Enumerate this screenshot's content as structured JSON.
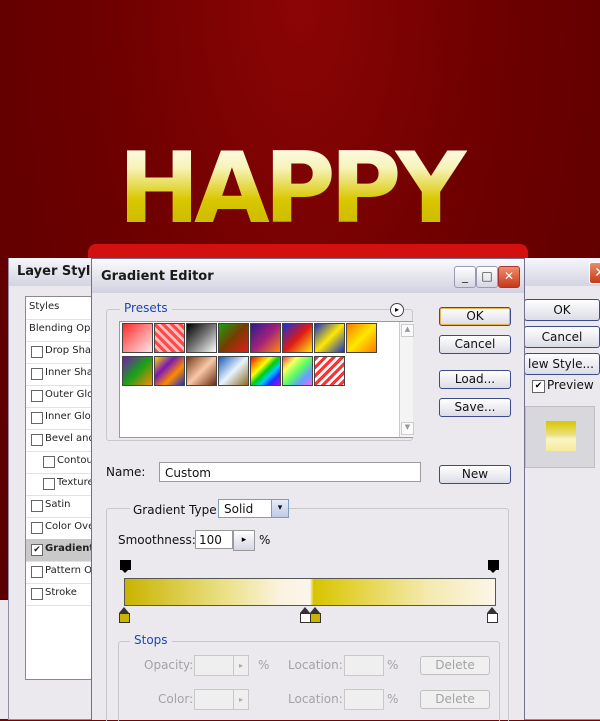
{
  "artwork": {
    "title_text": "HAPPY"
  },
  "layer_style": {
    "title": "Layer Style",
    "close_glyph": "✕",
    "styles_header": "Styles",
    "items": [
      {
        "label": "Blending Optio",
        "checkbox": false,
        "checked": false,
        "selected": false
      },
      {
        "label": "Drop Shad",
        "checkbox": true,
        "checked": false,
        "selected": false
      },
      {
        "label": "Inner Shac",
        "checkbox": true,
        "checked": false,
        "selected": false
      },
      {
        "label": "Outer Glow",
        "checkbox": true,
        "checked": false,
        "selected": false
      },
      {
        "label": "Inner Glow",
        "checkbox": true,
        "checked": false,
        "selected": false
      },
      {
        "label": "Bevel and E",
        "checkbox": true,
        "checked": false,
        "selected": false
      },
      {
        "label": "Contour",
        "checkbox": true,
        "checked": false,
        "selected": false
      },
      {
        "label": "Texture",
        "checkbox": true,
        "checked": false,
        "selected": false
      },
      {
        "label": "Satin",
        "checkbox": true,
        "checked": false,
        "selected": false
      },
      {
        "label": "Color Over",
        "checkbox": true,
        "checked": false,
        "selected": false
      },
      {
        "label": "Gradient C",
        "checkbox": true,
        "checked": true,
        "selected": true
      },
      {
        "label": "Pattern Ov",
        "checkbox": true,
        "checked": false,
        "selected": false
      },
      {
        "label": "Stroke",
        "checkbox": true,
        "checked": false,
        "selected": false
      }
    ],
    "ok_label": "OK",
    "cancel_label": "Cancel",
    "new_style_label": "lew Style...",
    "preview_label": "Preview",
    "preview_checked": true
  },
  "gradient_editor": {
    "title": "Gradient Editor",
    "minimize_glyph": "_",
    "maximize_glyph": "□",
    "close_glyph": "✕",
    "presets_label": "Presets",
    "presets_menu_glyph": "▸",
    "presets": [
      {
        "name": "red-to-transparent",
        "gradient": "linear-gradient(135deg,#ff2a2a 0%,#ff8a8a 50%,#ffe5e5 100%)"
      },
      {
        "name": "red-checker",
        "gradient": "repeating-linear-gradient(45deg,#ff4a4a 0 3px,#ffbdbd 3px 6px)"
      },
      {
        "name": "black-to-white",
        "gradient": "linear-gradient(135deg,#000 0%,#777 50%,#fff 100%)"
      },
      {
        "name": "red-to-green",
        "gradient": "linear-gradient(135deg,#1aa010 0%,#7a3a00 50%,#e21f1f 100%)"
      },
      {
        "name": "violet-to-orange",
        "gradient": "linear-gradient(135deg,#2d1a8c 0%,#a0207a 50%,#ff8a10 100%)"
      },
      {
        "name": "blue-red-yellow",
        "gradient": "linear-gradient(135deg,#1830d8 0%,#e01818 50%,#ffe810 100%)"
      },
      {
        "name": "blue-yellow-blue",
        "gradient": "linear-gradient(135deg,#1830c8 0%,#ffe800 50%,#1830c8 100%)"
      },
      {
        "name": "orange-yellow-orange",
        "gradient": "linear-gradient(135deg,#ff7a00 0%,#ffe800 50%,#ff7a00 100%)"
      },
      {
        "name": "violet-green-orange",
        "gradient": "linear-gradient(135deg,#7a18b8 0%,#18a018 50%,#ff8a00 100%)"
      },
      {
        "name": "yellow-violet-orange-blue",
        "gradient": "linear-gradient(135deg,#ffd800 0%,#7a18b8 35%,#ff8a00 65%,#1830c8 100%)"
      },
      {
        "name": "copper",
        "gradient": "linear-gradient(135deg,#7a3a18 0%,#f8c8a8 50%,#6a2a10 100%)"
      },
      {
        "name": "chrome",
        "gradient": "linear-gradient(135deg,#1a5ab8 0%,#e8f4ff 50%,#8a6a20 100%)"
      },
      {
        "name": "spectrum",
        "gradient": "linear-gradient(135deg,#ff0000 0%,#ff9a00 20%,#ffff00 35%,#00d000 50%,#00c8ff 65%,#1a30ff 80%,#c000ff 100%)"
      },
      {
        "name": "transparent-rainbow",
        "gradient": "linear-gradient(135deg,#ff4040 0%,#ffff60 25%,#60ff60 50%,#60a0ff 75%,#ff60ff 100%)"
      },
      {
        "name": "transparent-stripes",
        "gradient": "repeating-linear-gradient(135deg,#ff3030 0 3px,#ffffff 3px 6px)"
      }
    ],
    "ok_label": "OK",
    "cancel_label": "Cancel",
    "load_label": "Load...",
    "save_label": "Save...",
    "name_label": "Name:",
    "name_value": "Custom",
    "new_label": "New",
    "gradient_type_label": "Gradient Type:",
    "gradient_type_value": "Solid",
    "dropdown_glyph": "▾",
    "smoothness_label": "Smoothness:",
    "smoothness_value": "100",
    "smoothness_unit": "%",
    "stepper_glyph": "▸",
    "colors": {
      "stop_color": "#c9b400",
      "white_stop": "#ffffff"
    },
    "stops_label": "Stops",
    "opacity_label": "Opacity:",
    "opacity_unit": "%",
    "location_label": "Location:",
    "location_unit": "%",
    "delete_label": "Delete",
    "color_label": "Color:"
  }
}
